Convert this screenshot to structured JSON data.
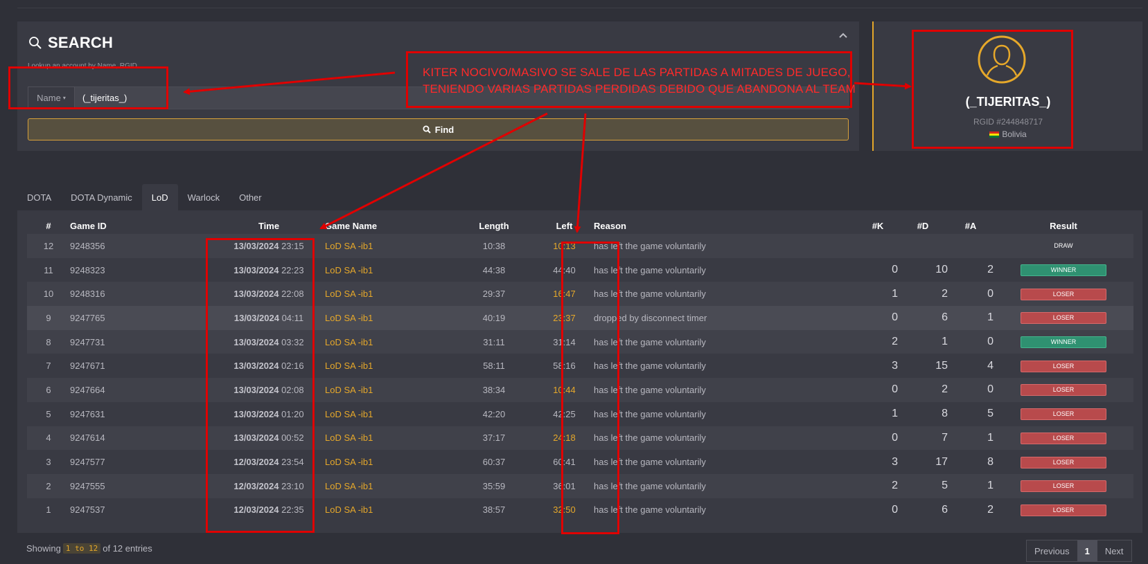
{
  "search": {
    "title": "SEARCH",
    "hint": "Lookup an account by Name, RGID",
    "type_label": "Name",
    "value": "(_tijeritas_)",
    "find_label": "Find"
  },
  "profile": {
    "name": "(_TIJERITAS_)",
    "rgid": "RGID #244848717",
    "country": "Bolivia",
    "flag_colors": [
      "#d52b1e",
      "#f9e300",
      "#007934"
    ],
    "accent": "#e6a82a"
  },
  "tabs": [
    "DOTA",
    "DOTA Dynamic",
    "LoD",
    "Warlock",
    "Other"
  ],
  "active_tab": "LoD",
  "table": {
    "headers": [
      "#",
      "Game ID",
      "Time",
      "Game Name",
      "Length",
      "Left",
      "Reason",
      "#K",
      "#D",
      "#A",
      "Result"
    ],
    "rows": [
      {
        "n": "12",
        "id": "9248356",
        "date": "13/03/2024",
        "time": "23:15",
        "game": "LoD SA -ib1",
        "length": "10:38",
        "left": "10:13",
        "left_hl": true,
        "reason": "has left the game voluntarily",
        "k": "",
        "d": "",
        "a": "",
        "result": "DRAW"
      },
      {
        "n": "11",
        "id": "9248323",
        "date": "13/03/2024",
        "time": "22:23",
        "game": "LoD SA -ib1",
        "length": "44:38",
        "left": "44:40",
        "left_hl": false,
        "reason": "has left the game voluntarily",
        "k": "0",
        "d": "10",
        "a": "2",
        "result": "WINNER"
      },
      {
        "n": "10",
        "id": "9248316",
        "date": "13/03/2024",
        "time": "22:08",
        "game": "LoD SA -ib1",
        "length": "29:37",
        "left": "16:47",
        "left_hl": true,
        "reason": "has left the game voluntarily",
        "k": "1",
        "d": "2",
        "a": "0",
        "result": "LOSER"
      },
      {
        "n": "9",
        "id": "9247765",
        "date": "13/03/2024",
        "time": "04:11",
        "game": "LoD SA -ib1",
        "length": "40:19",
        "left": "23:37",
        "left_hl": true,
        "reason": "dropped by disconnect timer",
        "k": "0",
        "d": "6",
        "a": "1",
        "result": "LOSER"
      },
      {
        "n": "8",
        "id": "9247731",
        "date": "13/03/2024",
        "time": "03:32",
        "game": "LoD SA -ib1",
        "length": "31:11",
        "left": "31:14",
        "left_hl": false,
        "reason": "has left the game voluntarily",
        "k": "2",
        "d": "1",
        "a": "0",
        "result": "WINNER"
      },
      {
        "n": "7",
        "id": "9247671",
        "date": "13/03/2024",
        "time": "02:16",
        "game": "LoD SA -ib1",
        "length": "58:11",
        "left": "58:16",
        "left_hl": false,
        "reason": "has left the game voluntarily",
        "k": "3",
        "d": "15",
        "a": "4",
        "result": "LOSER"
      },
      {
        "n": "6",
        "id": "9247664",
        "date": "13/03/2024",
        "time": "02:08",
        "game": "LoD SA -ib1",
        "length": "38:34",
        "left": "10:44",
        "left_hl": true,
        "reason": "has left the game voluntarily",
        "k": "0",
        "d": "2",
        "a": "0",
        "result": "LOSER"
      },
      {
        "n": "5",
        "id": "9247631",
        "date": "13/03/2024",
        "time": "01:20",
        "game": "LoD SA -ib1",
        "length": "42:20",
        "left": "42:25",
        "left_hl": false,
        "reason": "has left the game voluntarily",
        "k": "1",
        "d": "8",
        "a": "5",
        "result": "LOSER"
      },
      {
        "n": "4",
        "id": "9247614",
        "date": "13/03/2024",
        "time": "00:52",
        "game": "LoD SA -ib1",
        "length": "37:17",
        "left": "24:18",
        "left_hl": true,
        "reason": "has left the game voluntarily",
        "k": "0",
        "d": "7",
        "a": "1",
        "result": "LOSER"
      },
      {
        "n": "3",
        "id": "9247577",
        "date": "12/03/2024",
        "time": "23:54",
        "game": "LoD SA -ib1",
        "length": "60:37",
        "left": "60:41",
        "left_hl": false,
        "reason": "has left the game voluntarily",
        "k": "3",
        "d": "17",
        "a": "8",
        "result": "LOSER"
      },
      {
        "n": "2",
        "id": "9247555",
        "date": "12/03/2024",
        "time": "23:10",
        "game": "LoD SA -ib1",
        "length": "35:59",
        "left": "36:01",
        "left_hl": false,
        "reason": "has left the game voluntarily",
        "k": "2",
        "d": "5",
        "a": "1",
        "result": "LOSER"
      },
      {
        "n": "1",
        "id": "9247537",
        "date": "12/03/2024",
        "time": "22:35",
        "game": "LoD SA -ib1",
        "length": "38:57",
        "left": "32:50",
        "left_hl": true,
        "reason": "has left the game voluntarily",
        "k": "0",
        "d": "6",
        "a": "2",
        "result": "LOSER"
      }
    ]
  },
  "footer": {
    "showing_prefix": "Showing",
    "showing_range": "1 to 12",
    "showing_suffix": "of 12 entries",
    "prev": "Previous",
    "page": "1",
    "next": "Next"
  },
  "annotation": {
    "line1": "KITER NOCIVO/MASIVO SE SALE DE LAS PARTIDAS A MITADES DE JUEGO,",
    "line2": "TENIENDO VARIAS PARTIDAS PERDIDAS DEBIDO QUE ABANDONA AL TEAM",
    "color": "#e00000"
  }
}
